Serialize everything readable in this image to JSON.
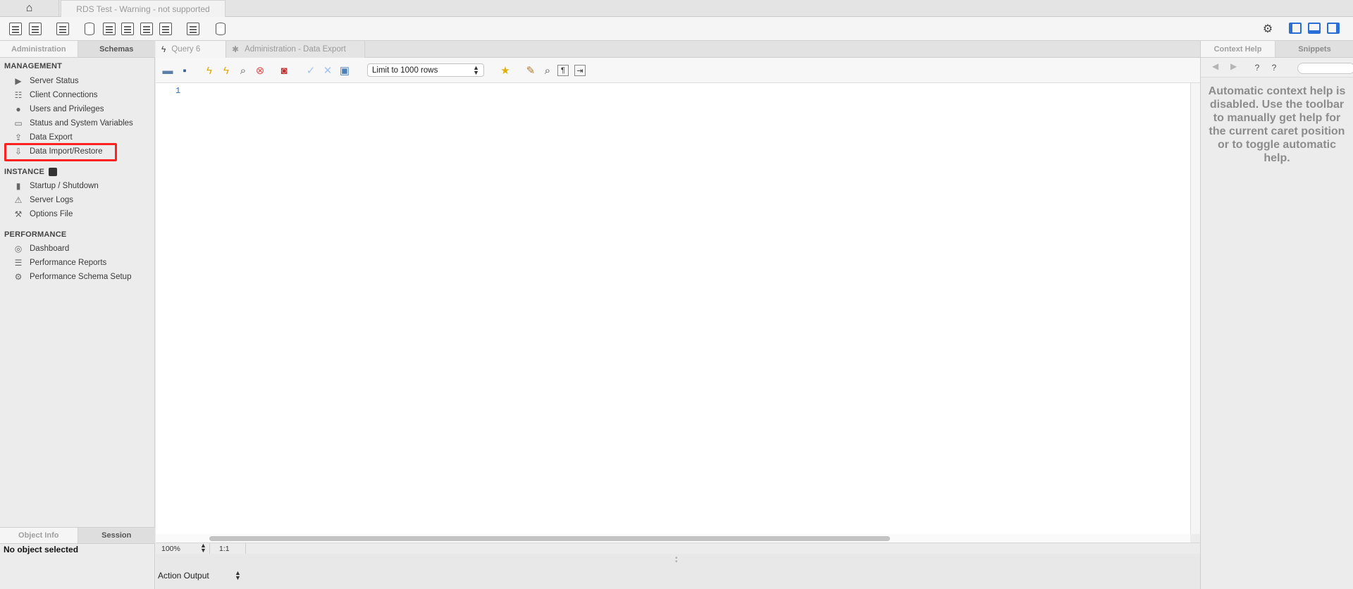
{
  "titlebar": {
    "connection_tab": "RDS Test - Warning - not supported"
  },
  "sidebar": {
    "tabs": [
      "Administration",
      "Schemas"
    ],
    "sections": {
      "management": "MANAGEMENT",
      "instance": "INSTANCE",
      "performance": "PERFORMANCE"
    },
    "management_items": [
      "Server Status",
      "Client Connections",
      "Users and Privileges",
      "Status and System Variables",
      "Data Export",
      "Data Import/Restore"
    ],
    "instance_items": [
      "Startup / Shutdown",
      "Server Logs",
      "Options File"
    ],
    "performance_items": [
      "Dashboard",
      "Performance Reports",
      "Performance Schema Setup"
    ],
    "object_tabs": [
      "Object Info",
      "Session"
    ],
    "object_status": "No object selected"
  },
  "editor": {
    "tabs": [
      "Query 6",
      "Administration - Data Export"
    ],
    "limit_select": "Limit to 1000 rows",
    "line_number": "1"
  },
  "statusbar": {
    "zoom": "100%",
    "caret": "1:1"
  },
  "output": {
    "selector": "Action Output"
  },
  "right_panel": {
    "tabs": [
      "Context Help",
      "Snippets"
    ],
    "help_text": "Automatic context help is disabled. Use the toolbar to manually get help for the current caret position or to toggle automatic help."
  },
  "colors": {
    "highlight": "#ff2020",
    "accent": "#2a6fd6"
  }
}
